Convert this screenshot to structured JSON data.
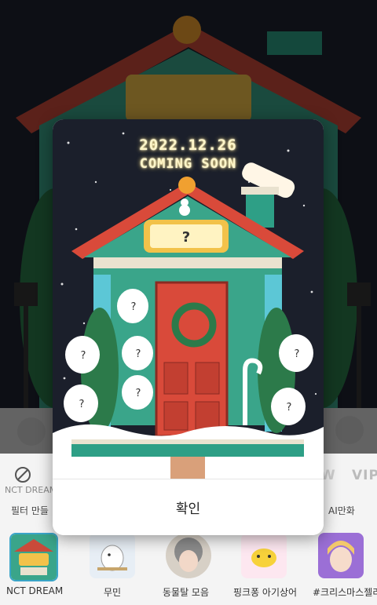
{
  "modal": {
    "date": "2022.12.26",
    "headline": "COMING SOON",
    "confirm_label": "확인"
  },
  "background": {
    "filter_row": {
      "left_label": "필터 만들",
      "right_label": "AI만화",
      "small_caption": "NCT DREAM",
      "vip_tag": "VIP",
      "w_tag": "W"
    },
    "filters": [
      {
        "label": "NCT DREAM",
        "selected": true
      },
      {
        "label": "무민",
        "selected": false
      },
      {
        "label": "동물탈 모음",
        "selected": false
      },
      {
        "label": "핑크퐁 아기상어",
        "selected": false
      },
      {
        "label": "#크리스마스젤리",
        "selected": false
      }
    ]
  },
  "colors": {
    "accent_teal": "#2e9f86",
    "door_red": "#d94a3a",
    "night_sky": "#1b1f2b",
    "date_glow": "#ffe27a"
  }
}
